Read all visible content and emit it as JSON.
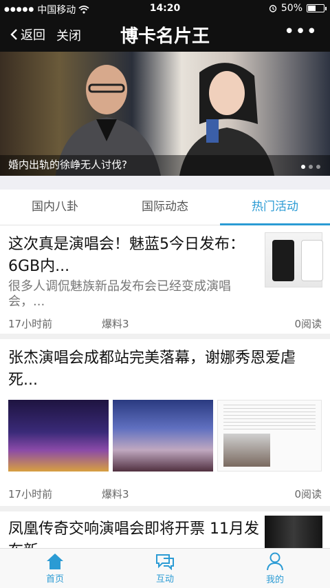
{
  "status_bar": {
    "carrier": "中国移动",
    "time": "14:20",
    "battery_text": "50%",
    "battery_level": 0.5
  },
  "nav": {
    "back_label": "返回",
    "close_label": "关闭",
    "title": "博卡名片王",
    "more_label": "•••"
  },
  "banner": {
    "caption": "婚内出轨的徐峥无人讨伐?",
    "page_count": 3,
    "active_page": 1
  },
  "tabs": [
    {
      "label": "国内八卦",
      "active": false
    },
    {
      "label": "国际动态",
      "active": false
    },
    {
      "label": "热门活动",
      "active": true
    }
  ],
  "feed": [
    {
      "headline_line1": "这次真是演唱会！魅蓝5今日发布：",
      "headline_line2": "6GB内...",
      "summary_line1": "很多人调侃魅族新品发布会已经变成演唱",
      "summary_line2": "会，...",
      "time": "17小时前",
      "source": "爆料3",
      "reads": "0阅读"
    },
    {
      "headline_line1": "张杰演唱会成都站完美落幕，谢娜秀恩爱虐",
      "headline_line2": "死...",
      "time": "17小时前",
      "source": "爆料3",
      "reads": "0阅读"
    },
    {
      "headline_line1": "凤凰传奇交响演唱会即将开票 11月发",
      "headline_line2": "布新..."
    }
  ],
  "bottom_nav": [
    {
      "label": "首页",
      "icon": "home-icon"
    },
    {
      "label": "互动",
      "icon": "chat-icon"
    },
    {
      "label": "我的",
      "icon": "user-icon"
    }
  ],
  "colors": {
    "accent": "#2b9bd4",
    "header_bg": "#101010"
  }
}
